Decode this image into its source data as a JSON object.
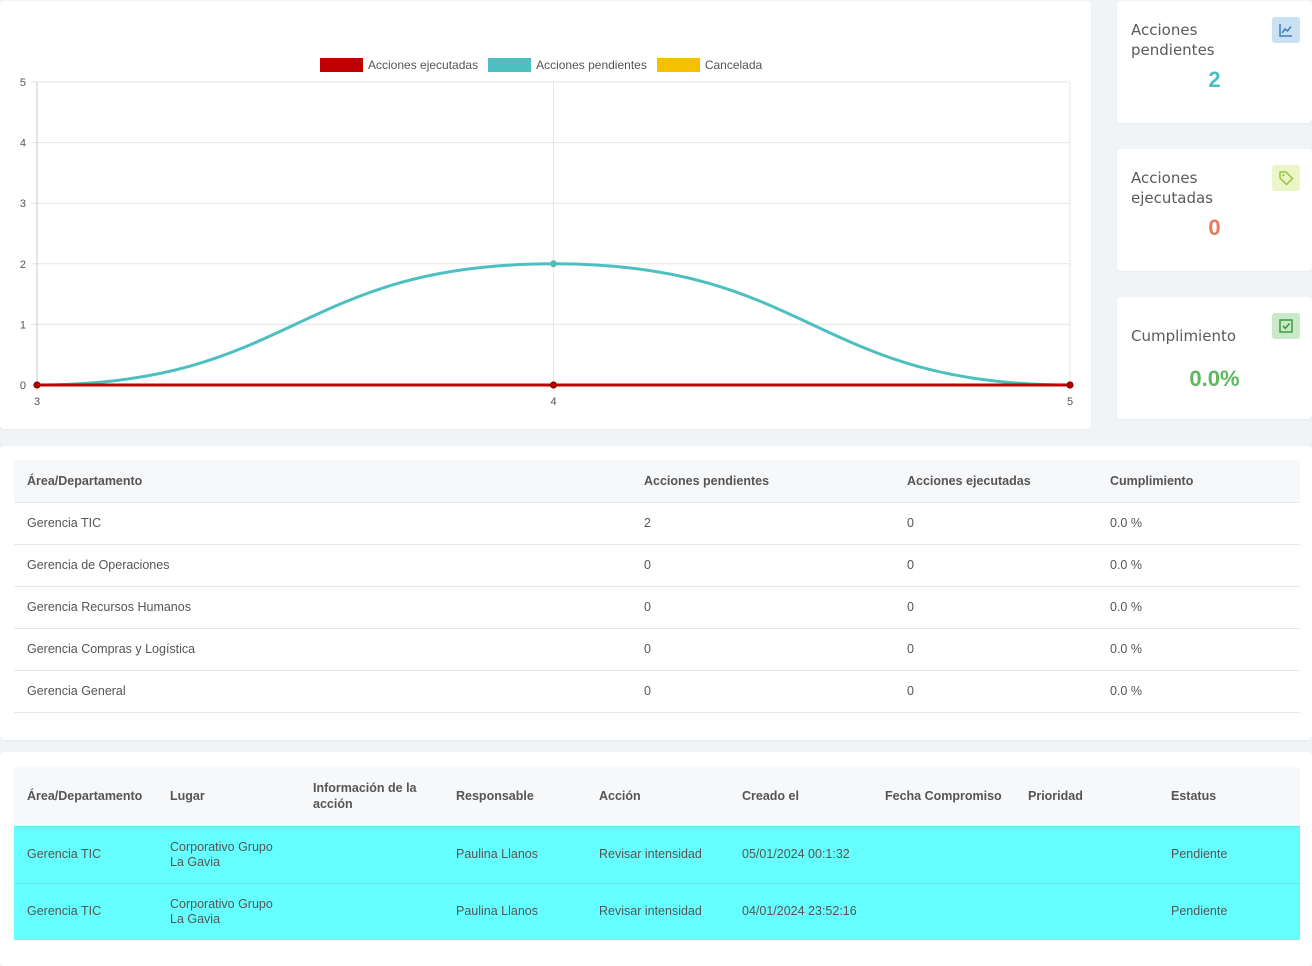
{
  "chart_data": {
    "type": "line",
    "x": [
      3,
      4,
      5
    ],
    "ylim": [
      0,
      5
    ],
    "yticks": [
      0,
      1,
      2,
      3,
      4,
      5
    ],
    "legend_position": "top-center",
    "series": [
      {
        "name": "Acciones ejecutadas",
        "color": "#c00000",
        "values": [
          0,
          0,
          0
        ]
      },
      {
        "name": "Acciones pendientes",
        "color": "#4dbfc0",
        "values": [
          0,
          2,
          0
        ]
      },
      {
        "name": "Cancelada",
        "color": "#f5c000",
        "values": [
          0,
          0,
          0
        ]
      }
    ]
  },
  "stats": [
    {
      "title": "Acciones pendientes",
      "value": "2",
      "color": "#4dbfc0",
      "icon": "line-chart-icon",
      "icon_bg": "#c9e1f3",
      "icon_color": "#3d7fc1"
    },
    {
      "title": "Acciones ejecutadas",
      "value": "0",
      "color": "#e8785e",
      "icon": "tag-icon",
      "icon_bg": "#eaf5c8",
      "icon_color": "#9ac23c"
    },
    {
      "title": "Cumplimiento",
      "value": "0.0%",
      "color": "#5cb85c",
      "icon": "checkbox-icon",
      "icon_bg": "#c8eac8",
      "icon_color": "#3f9a3f"
    }
  ],
  "dept_table": {
    "headers": [
      "Área/Departamento",
      "Acciones pendientes",
      "Acciones ejecutadas",
      "Cumplimiento"
    ],
    "rows": [
      [
        "Gerencia TIC",
        "2",
        "0",
        "0.0 %"
      ],
      [
        "Gerencia de Operaciones",
        "0",
        "0",
        "0.0 %"
      ],
      [
        "Gerencia Recursos Humanos",
        "0",
        "0",
        "0.0 %"
      ],
      [
        "Gerencia Compras y Logística",
        "0",
        "0",
        "0.0 %"
      ],
      [
        "Gerencia General",
        "0",
        "0",
        "0.0 %"
      ]
    ]
  },
  "actions_table": {
    "headers": [
      "Área/Departamento",
      "Lugar",
      "Información de la acción",
      "Responsable",
      "Acción",
      "Creado el",
      "Fecha Compromiso",
      "Prioridad",
      "Estatus"
    ],
    "rows": [
      [
        "Gerencia TIC",
        "Corporativo Grupo La Gavia",
        "",
        "Paulina Llanos",
        "Revisar intensidad",
        "05/01/2024 00:1:32",
        "",
        "",
        "Pendiente"
      ],
      [
        "Gerencia TIC",
        "Corporativo Grupo La Gavia",
        "",
        "Paulina Llanos",
        "Revisar intensidad",
        "04/01/2024 23:52:16",
        "",
        "",
        "Pendiente"
      ]
    ]
  }
}
